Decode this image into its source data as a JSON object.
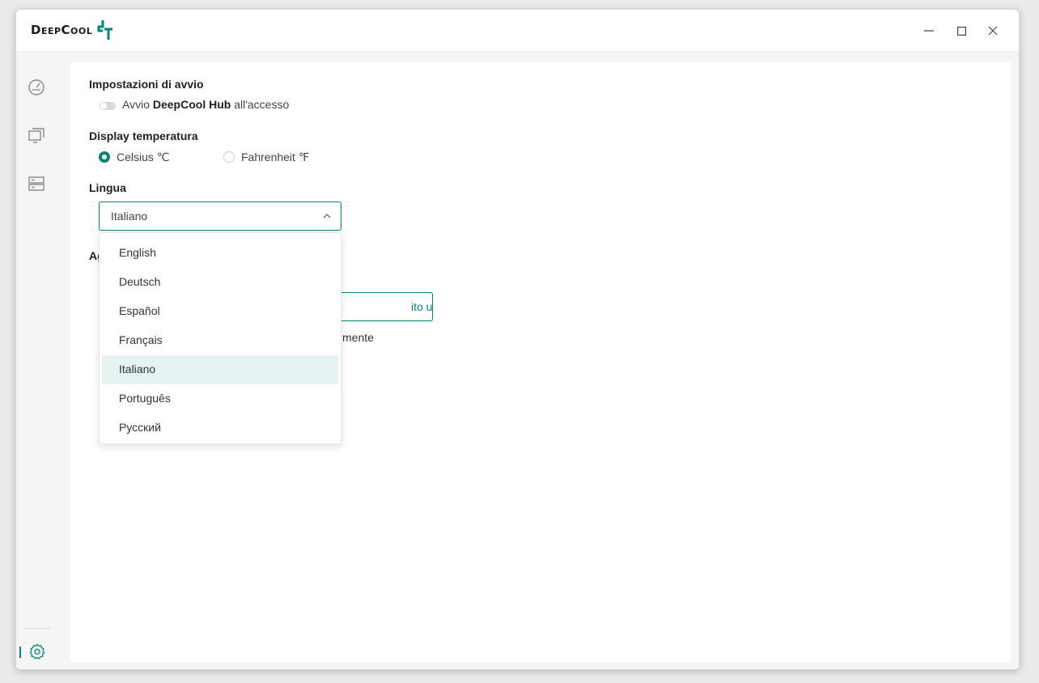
{
  "app": {
    "logo_text": "DeepCool",
    "colors": {
      "accent": "#00857a",
      "selected_bg": "#e5f3f2"
    }
  },
  "window_controls": [
    "minimize-icon",
    "maximize-icon",
    "close-icon"
  ],
  "sidebar": {
    "items": [
      {
        "icon": "dashboard-gauge-icon",
        "active": false
      },
      {
        "icon": "monitor-devices-icon",
        "active": false
      },
      {
        "icon": "storage-server-icon",
        "active": false
      },
      {
        "icon": "gear-icon",
        "active": true
      }
    ]
  },
  "settings": {
    "startup": {
      "title": "Impostazioni di avvio",
      "toggle_prefix": "Avvio ",
      "toggle_bold": "DeepCool Hub",
      "toggle_suffix": " all'accesso",
      "enabled": false
    },
    "temperature": {
      "title": "Display temperatura",
      "options": [
        {
          "label": "Celsius ℃",
          "checked": true
        },
        {
          "label": "Fahrenheit ℉",
          "checked": false
        }
      ]
    },
    "language": {
      "title": "Lingua",
      "selected": "Italiano",
      "options": [
        "English",
        "Deutsch",
        "Español",
        "Français",
        "Italiano",
        "Português",
        "Русский"
      ]
    },
    "partially_hidden": {
      "section_title_fragment": "Ag",
      "button_fragment": "ito ufficiale",
      "line_fragment": "mente"
    }
  }
}
